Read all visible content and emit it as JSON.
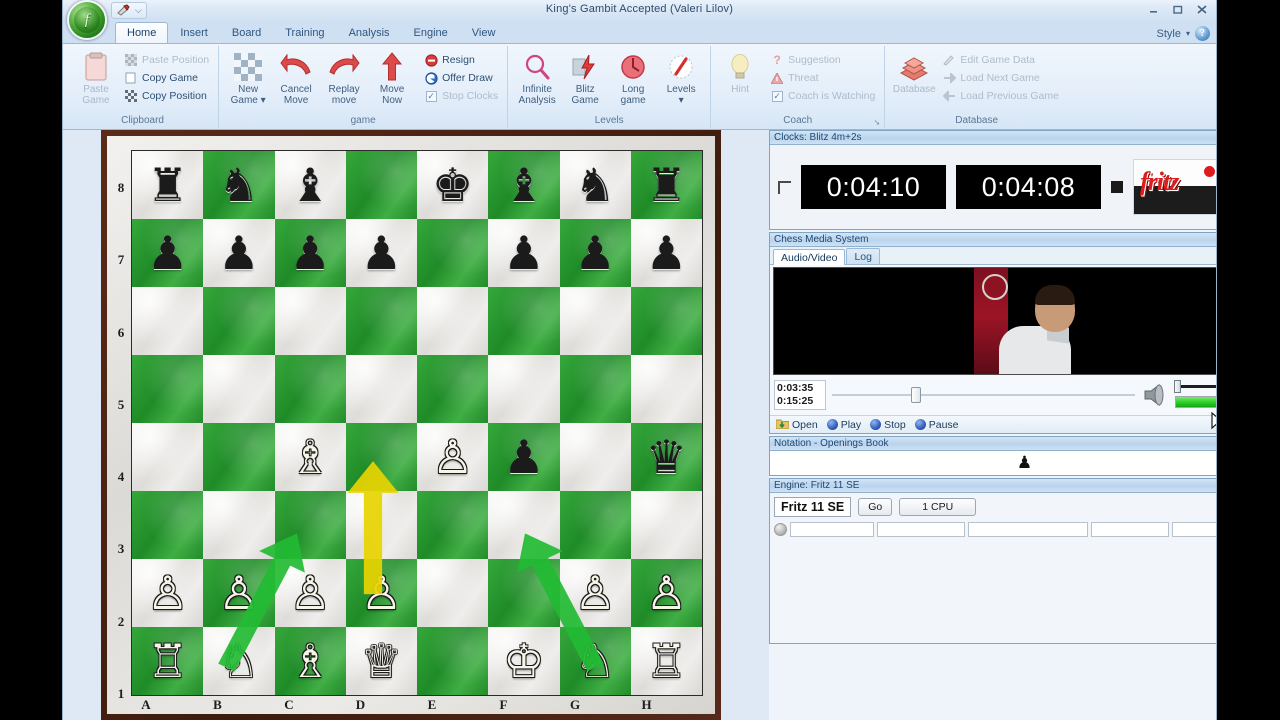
{
  "window": {
    "title": "King's Gambit Accepted  (Valeri Lilov)",
    "minimize": "–",
    "maximize": "□",
    "close": "✕",
    "qat_dropdown": "⌵",
    "orb_letter": "f"
  },
  "ribbon": {
    "tabs": [
      {
        "label": "Home",
        "active": true
      },
      {
        "label": "Insert",
        "active": false
      },
      {
        "label": "Board",
        "active": false
      },
      {
        "label": "Training",
        "active": false
      },
      {
        "label": "Analysis",
        "active": false
      },
      {
        "label": "Engine",
        "active": false
      },
      {
        "label": "View",
        "active": false
      }
    ],
    "style_label": "Style",
    "style_caret": "▾",
    "help_glyph": "?",
    "groups": [
      {
        "name": "Clipboard",
        "label": "Clipboard",
        "big": [
          {
            "label_top": "Paste",
            "label_bottom": "Game",
            "icon": "paste-icon",
            "disabled": true
          }
        ],
        "small": [
          {
            "label": "Paste Position",
            "icon": "paste-position-icon",
            "disabled": true
          },
          {
            "label": "Copy Game",
            "icon": "copy-game-icon",
            "disabled": false
          },
          {
            "label": "Copy Position",
            "icon": "copy-position-icon",
            "disabled": false
          }
        ]
      },
      {
        "name": "game",
        "label": "game",
        "big": [
          {
            "label_top": "New",
            "label_bottom": "Game ▾",
            "icon": "new-game-icon",
            "disabled": false
          },
          {
            "label_top": "Cancel",
            "label_bottom": "Move",
            "icon": "cancel-move-icon",
            "disabled": false
          },
          {
            "label_top": "Replay",
            "label_bottom": "move",
            "icon": "replay-move-icon",
            "disabled": false
          },
          {
            "label_top": "Move",
            "label_bottom": "Now",
            "icon": "move-now-icon",
            "disabled": false
          }
        ],
        "small": [
          {
            "label": "Resign",
            "icon": "resign-icon",
            "disabled": false
          },
          {
            "label": "Offer Draw",
            "icon": "offer-draw-icon",
            "disabled": false
          },
          {
            "label": "Stop Clocks",
            "icon": "stop-clocks-checkbox",
            "disabled": true,
            "checked": true
          }
        ]
      },
      {
        "name": "Levels",
        "label": "Levels",
        "big": [
          {
            "label_top": "Infinite",
            "label_bottom": "Analysis",
            "icon": "infinite-analysis-icon",
            "disabled": false
          },
          {
            "label_top": "Blitz",
            "label_bottom": "Game",
            "icon": "blitz-game-icon",
            "disabled": false
          },
          {
            "label_top": "Long",
            "label_bottom": "game",
            "icon": "long-game-icon",
            "disabled": false
          },
          {
            "label_top": "Levels",
            "label_bottom": "▾",
            "icon": "levels-icon",
            "disabled": false
          }
        ],
        "small": []
      },
      {
        "name": "Coach",
        "label": "Coach",
        "dialog_launcher": "➘",
        "big": [
          {
            "label_top": "Hint",
            "label_bottom": "",
            "icon": "hint-icon",
            "disabled": true
          }
        ],
        "small": [
          {
            "label": "Suggestion",
            "icon": "suggestion-icon",
            "disabled": true
          },
          {
            "label": "Threat",
            "icon": "threat-icon",
            "disabled": true
          },
          {
            "label": "Coach is Watching",
            "icon": "coach-watching-checkbox",
            "disabled": true,
            "checked": true
          }
        ]
      },
      {
        "name": "Database",
        "label": "Database",
        "big": [
          {
            "label_top": "Database",
            "label_bottom": "",
            "icon": "database-icon",
            "disabled": true
          }
        ],
        "small": [
          {
            "label": "Edit Game Data",
            "icon": "edit-game-data-icon",
            "disabled": true
          },
          {
            "label": "Load Next Game",
            "icon": "load-next-game-icon",
            "disabled": true
          },
          {
            "label": "Load Previous Game",
            "icon": "load-previous-game-icon",
            "disabled": true
          }
        ]
      }
    ]
  },
  "board": {
    "files": [
      "A",
      "B",
      "C",
      "D",
      "E",
      "F",
      "G",
      "H"
    ],
    "ranks": [
      "8",
      "7",
      "6",
      "5",
      "4",
      "3",
      "2",
      "1"
    ],
    "position": [
      [
        "r",
        "n",
        "b",
        "",
        "k",
        "b",
        "n",
        "r"
      ],
      [
        "p",
        "p",
        "p",
        "p",
        "",
        "p",
        "p",
        "p"
      ],
      [
        "",
        "",
        "",
        "",
        "",
        "",
        "",
        ""
      ],
      [
        "",
        "",
        "",
        "",
        "",
        "",
        "",
        ""
      ],
      [
        "",
        "",
        "B",
        "",
        "P",
        "p",
        "",
        "q"
      ],
      [
        "",
        "",
        "",
        "",
        "",
        "",
        "",
        ""
      ],
      [
        "P",
        "P",
        "P",
        "P",
        "",
        "",
        "P",
        "P"
      ],
      [
        "R",
        "N",
        "B",
        "Q",
        "",
        "K",
        "N",
        "R"
      ]
    ],
    "arrows": [
      {
        "name": "arrow-b1-c3",
        "from": "b1",
        "to": "c3",
        "color": "#22bb33"
      },
      {
        "name": "arrow-d2-d4",
        "from": "d2",
        "to": "d4",
        "color": "#e8d400"
      },
      {
        "name": "arrow-g1-f3",
        "from": "g1",
        "to": "f3",
        "color": "#22bb33"
      }
    ]
  },
  "panels": {
    "clocks": {
      "title": "Clocks: Blitz 4m+2s",
      "white_time": "0:04:10",
      "black_time": "0:04:08",
      "brand": "fritz",
      "collapse": "▾",
      "close": "✕"
    },
    "media": {
      "title": "Chess Media System",
      "tabs": [
        {
          "label": "Audio/Video",
          "active": true
        },
        {
          "label": "Log",
          "active": false
        }
      ],
      "elapsed": "0:03:35",
      "total": "0:15:25",
      "controls": [
        {
          "label": "Open",
          "icon": "open-folder-icon"
        },
        {
          "label": "Play",
          "icon": "play-icon"
        },
        {
          "label": "Stop",
          "icon": "stop-icon"
        },
        {
          "label": "Pause",
          "icon": "pause-icon"
        }
      ],
      "volume_percent": 65,
      "seek_percent": 26,
      "collapse": "▾",
      "close": "✕"
    },
    "notation": {
      "title": "Notation - Openings Book",
      "side_to_move": "♟",
      "collapse": "▾",
      "close": "✕"
    },
    "engine": {
      "title": "Engine: Fritz 11 SE",
      "name": "Fritz 11 SE",
      "go_label": "Go",
      "cpu_label": "1 CPU",
      "fields": [
        "",
        "",
        "",
        "",
        ""
      ],
      "collapse": "▾",
      "close": "✕"
    }
  },
  "colors": {
    "light_square": "#e7e5e1",
    "dark_square": "#2a9a31",
    "accent": "#e01b1b",
    "chrome": "#cfe0f2"
  }
}
